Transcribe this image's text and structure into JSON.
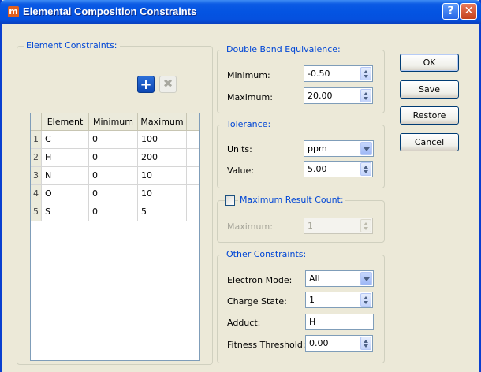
{
  "window": {
    "title": "Elemental Composition Constraints",
    "help_label": "?",
    "close_label": "✕"
  },
  "element_constraints": {
    "legend": "Element Constraints:",
    "add_icon": "plus-icon",
    "remove_icon": "x-icon",
    "columns": [
      "Element",
      "Minimum",
      "Maximum"
    ],
    "rows": [
      {
        "num": "1",
        "element": "C",
        "minimum": "0",
        "maximum": "100"
      },
      {
        "num": "2",
        "element": "H",
        "minimum": "0",
        "maximum": "200"
      },
      {
        "num": "3",
        "element": "N",
        "minimum": "0",
        "maximum": "10"
      },
      {
        "num": "4",
        "element": "O",
        "minimum": "0",
        "maximum": "10"
      },
      {
        "num": "5",
        "element": "S",
        "minimum": "0",
        "maximum": "5"
      }
    ]
  },
  "dbe": {
    "legend": "Double Bond Equivalence:",
    "minimum_label": "Minimum:",
    "minimum_value": "-0.50",
    "maximum_label": "Maximum:",
    "maximum_value": "20.00"
  },
  "tolerance": {
    "legend": "Tolerance:",
    "units_label": "Units:",
    "units_value": "ppm",
    "value_label": "Value:",
    "value_value": "5.00"
  },
  "max_result": {
    "legend": "Maximum Result Count:",
    "checked": false,
    "maximum_label": "Maximum:",
    "maximum_value": "1"
  },
  "other": {
    "legend": "Other Constraints:",
    "electron_mode_label": "Electron Mode:",
    "electron_mode_value": "All",
    "charge_state_label": "Charge State:",
    "charge_state_value": "1",
    "adduct_label": "Adduct:",
    "adduct_value": "H",
    "fitness_label": "Fitness Threshold:",
    "fitness_value": "0.00"
  },
  "buttons": {
    "ok": "OK",
    "save": "Save",
    "restore": "Restore",
    "cancel": "Cancel"
  }
}
